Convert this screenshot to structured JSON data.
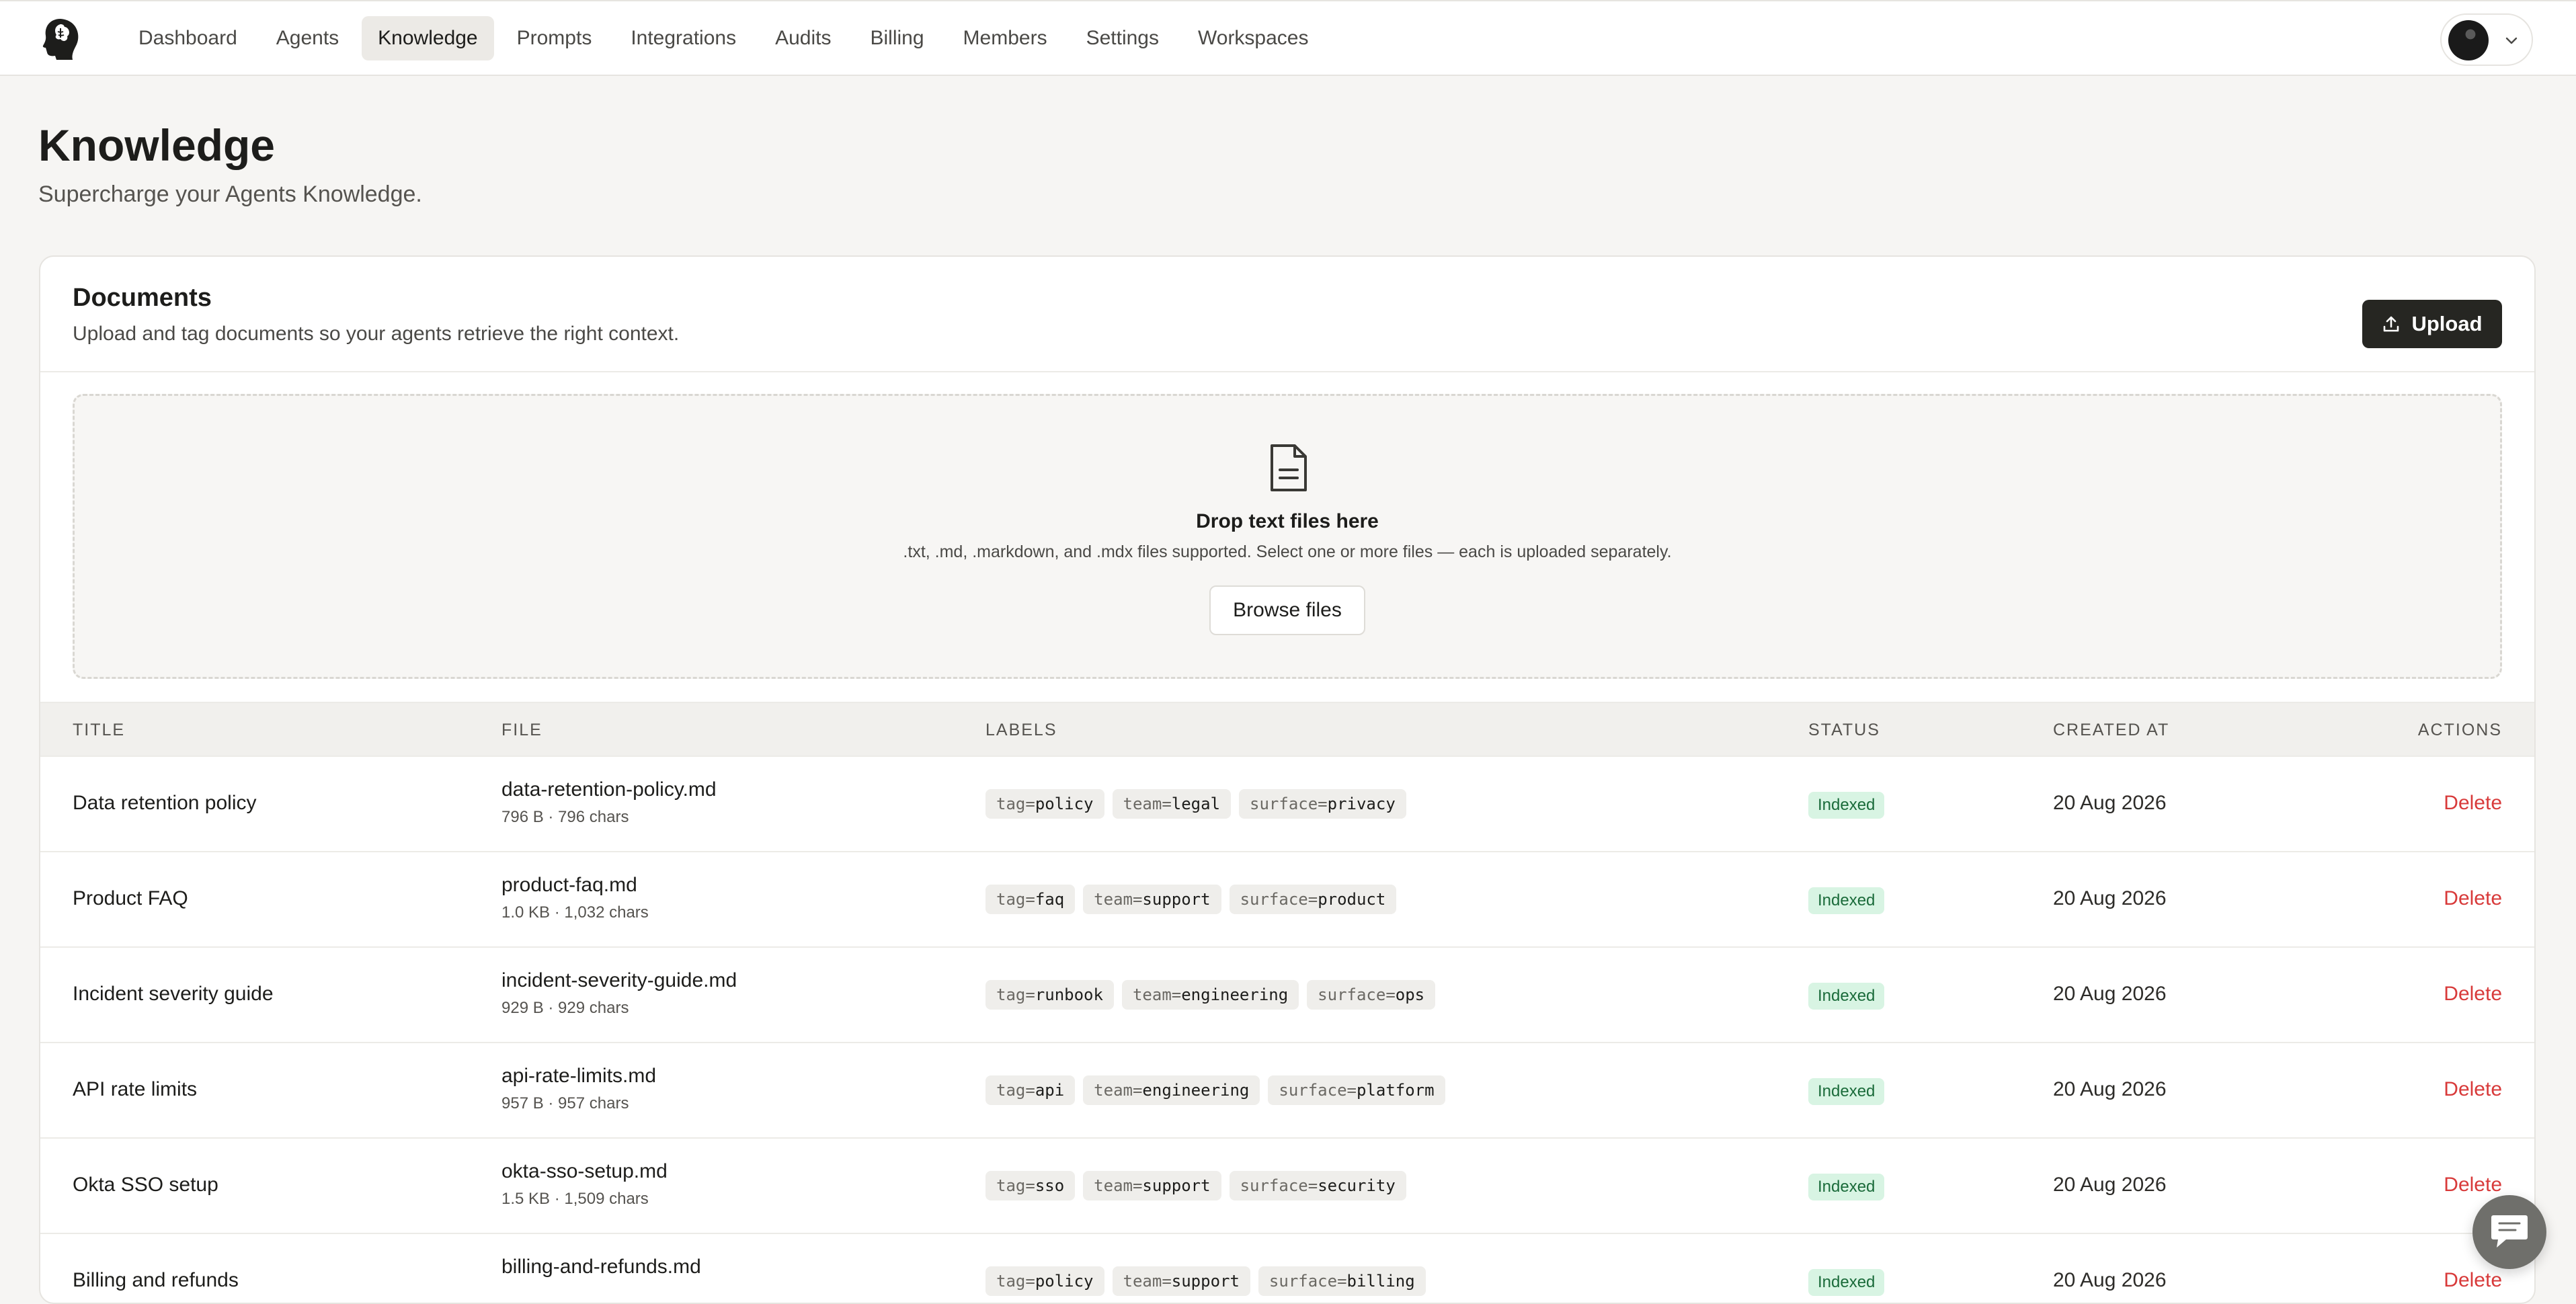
{
  "app": {
    "nav": [
      {
        "label": "Dashboard",
        "active": false
      },
      {
        "label": "Agents",
        "active": false
      },
      {
        "label": "Knowledge",
        "active": true
      },
      {
        "label": "Prompts",
        "active": false
      },
      {
        "label": "Integrations",
        "active": false
      },
      {
        "label": "Audits",
        "active": false
      },
      {
        "label": "Billing",
        "active": false
      },
      {
        "label": "Members",
        "active": false
      },
      {
        "label": "Settings",
        "active": false
      },
      {
        "label": "Workspaces",
        "active": false
      }
    ],
    "logo_icon": "head-silhouette-icon",
    "account_icon": "chevron-down-icon"
  },
  "page": {
    "title": "Knowledge",
    "subtitle": "Supercharge your Agents Knowledge."
  },
  "documents": {
    "title": "Documents",
    "subtitle": "Upload and tag documents so your agents retrieve the right context.",
    "upload_label": "Upload",
    "dropzone": {
      "title": "Drop text files here",
      "hint": ".txt, .md, .markdown, and .mdx files supported. Select one or more files — each is uploaded separately.",
      "browse_label": "Browse files"
    },
    "columns": {
      "title": "TITLE",
      "file": "FILE",
      "labels": "LABELS",
      "status": "STATUS",
      "created": "CREATED AT",
      "actions": "ACTIONS"
    },
    "rows": [
      {
        "title": "Data retention policy",
        "file": "data-retention-policy.md",
        "meta": "796 B · 796 chars",
        "labels": [
          {
            "k": "tag",
            "v": "policy"
          },
          {
            "k": "team",
            "v": "legal"
          },
          {
            "k": "surface",
            "v": "privacy"
          }
        ],
        "status": "Indexed",
        "created": "20 Aug 2026",
        "action": "Delete"
      },
      {
        "title": "Product FAQ",
        "file": "product-faq.md",
        "meta": "1.0 KB · 1,032 chars",
        "labels": [
          {
            "k": "tag",
            "v": "faq"
          },
          {
            "k": "team",
            "v": "support"
          },
          {
            "k": "surface",
            "v": "product"
          }
        ],
        "status": "Indexed",
        "created": "20 Aug 2026",
        "action": "Delete"
      },
      {
        "title": "Incident severity guide",
        "file": "incident-severity-guide.md",
        "meta": "929 B · 929 chars",
        "labels": [
          {
            "k": "tag",
            "v": "runbook"
          },
          {
            "k": "team",
            "v": "engineering"
          },
          {
            "k": "surface",
            "v": "ops"
          }
        ],
        "status": "Indexed",
        "created": "20 Aug 2026",
        "action": "Delete"
      },
      {
        "title": "API rate limits",
        "file": "api-rate-limits.md",
        "meta": "957 B · 957 chars",
        "labels": [
          {
            "k": "tag",
            "v": "api"
          },
          {
            "k": "team",
            "v": "engineering"
          },
          {
            "k": "surface",
            "v": "platform"
          }
        ],
        "status": "Indexed",
        "created": "20 Aug 2026",
        "action": "Delete"
      },
      {
        "title": "Okta SSO setup",
        "file": "okta-sso-setup.md",
        "meta": "1.5 KB · 1,509 chars",
        "labels": [
          {
            "k": "tag",
            "v": "sso"
          },
          {
            "k": "team",
            "v": "support"
          },
          {
            "k": "surface",
            "v": "security"
          }
        ],
        "status": "Indexed",
        "created": "20 Aug 2026",
        "action": "Delete"
      },
      {
        "title": "Billing and refunds",
        "file": "billing-and-refunds.md",
        "meta": "",
        "labels": [
          {
            "k": "tag",
            "v": "policy"
          },
          {
            "k": "team",
            "v": "support"
          },
          {
            "k": "surface",
            "v": "billing"
          }
        ],
        "status": "Indexed",
        "created": "20 Aug 2026",
        "action": "Delete"
      }
    ]
  },
  "colors": {
    "accent_dark": "#262622",
    "delete_red": "#d83a3a",
    "status_green_bg": "#d8f4e3",
    "status_green_text": "#1a6b3a"
  }
}
